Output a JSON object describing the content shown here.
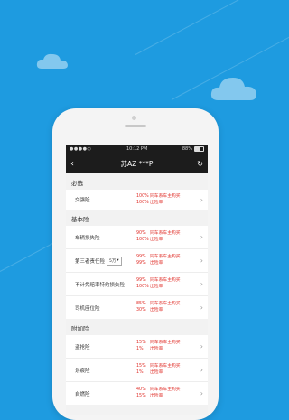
{
  "status_bar": {
    "signal": "●●●●○",
    "time": "10:12 PM",
    "battery": "88%"
  },
  "nav": {
    "title": "苏AZ ***P",
    "back_icon": "chevron-left-icon",
    "refresh_icon": "refresh-icon"
  },
  "sections": [
    {
      "title": "必选",
      "rows": [
        {
          "name": "交强险",
          "rates": [
            {
              "pct": "100%",
              "text": "同车系车主购买"
            },
            {
              "pct": "100%",
              "text": "出险率"
            }
          ]
        }
      ]
    },
    {
      "title": "基本险",
      "rows": [
        {
          "name": "车辆损失险",
          "rates": [
            {
              "pct": "90%",
              "text": "同车系车主购买"
            },
            {
              "pct": "100%",
              "text": "出险率"
            }
          ]
        },
        {
          "name": "第三者责任险",
          "option": "5万",
          "rates": [
            {
              "pct": "99%",
              "text": "同车系车主购买"
            },
            {
              "pct": "99%",
              "text": "出险率"
            }
          ]
        },
        {
          "name": "不计免赔率特约损失险",
          "rates": [
            {
              "pct": "99%",
              "text": "同车系车主购买"
            },
            {
              "pct": "100%",
              "text": "出险率"
            }
          ]
        },
        {
          "name": "司机座位险",
          "rates": [
            {
              "pct": "85%",
              "text": "同车系车主购买"
            },
            {
              "pct": "30%",
              "text": "出险率"
            }
          ]
        }
      ]
    },
    {
      "title": "附加险",
      "rows": [
        {
          "name": "盗抢险",
          "rates": [
            {
              "pct": "15%",
              "text": "同车系车主购买"
            },
            {
              "pct": "1%",
              "text": "出险率"
            }
          ]
        },
        {
          "name": "划痕险",
          "rates": [
            {
              "pct": "15%",
              "text": "同车系车主购买"
            },
            {
              "pct": "1%",
              "text": "出险率"
            }
          ]
        },
        {
          "name": "自燃险",
          "rates": [
            {
              "pct": "40%",
              "text": "同车系车主购买"
            },
            {
              "pct": "15%",
              "text": "出险率"
            }
          ]
        }
      ]
    }
  ],
  "colors": {
    "background": "#1e9be0",
    "rate_red": "#e0302a",
    "navbar": "#1c1c1c"
  }
}
